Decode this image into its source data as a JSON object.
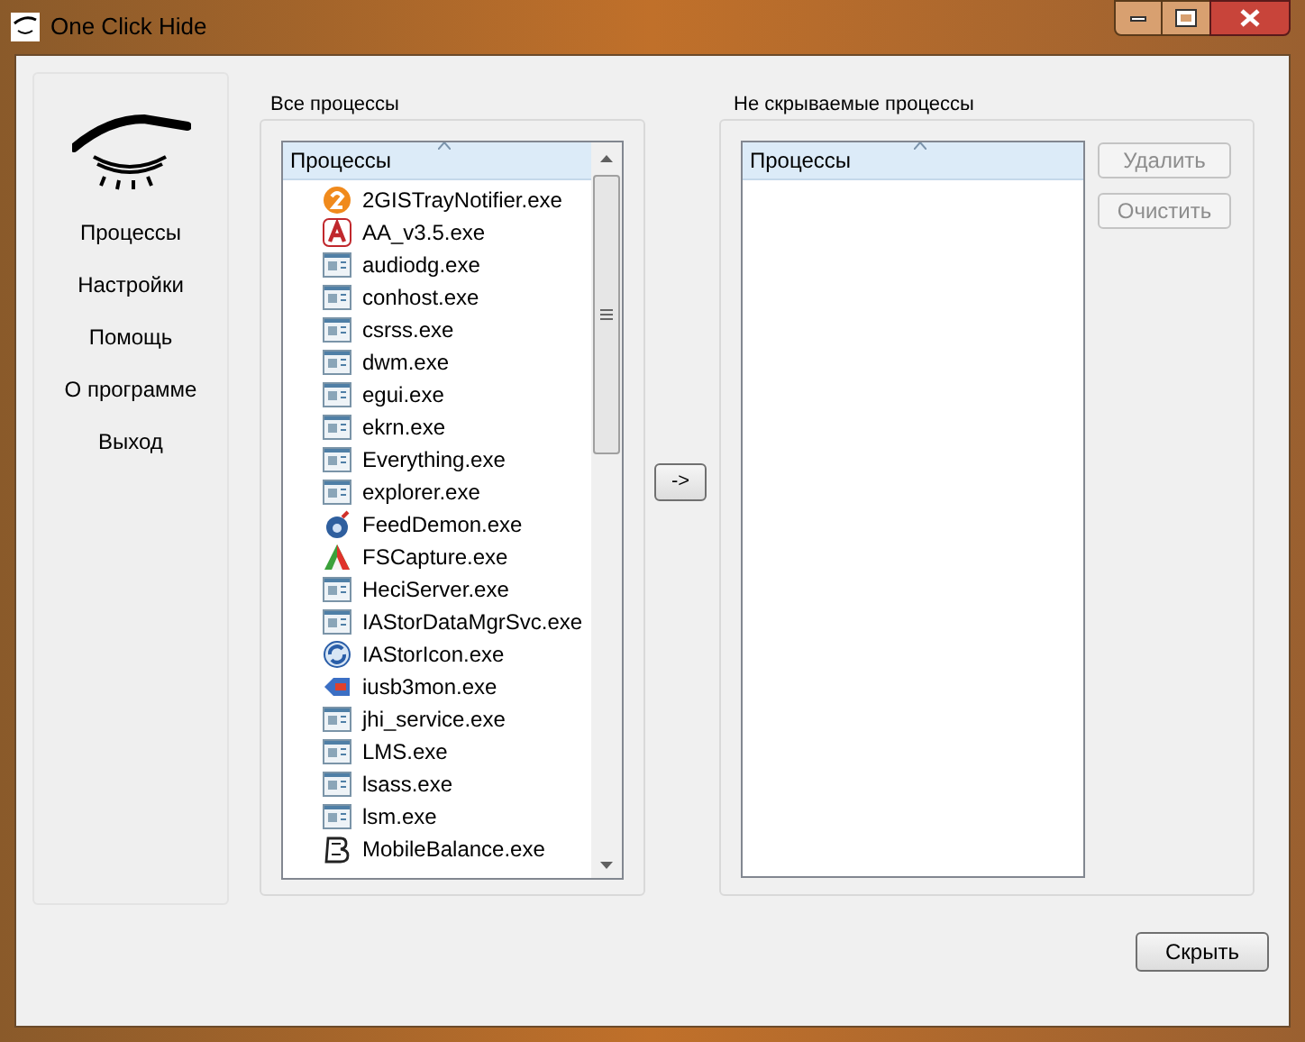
{
  "window": {
    "title": "One Click Hide"
  },
  "sidebar": {
    "items": [
      {
        "label": "Процессы"
      },
      {
        "label": "Настройки"
      },
      {
        "label": "Помощь"
      },
      {
        "label": "О программе"
      },
      {
        "label": "Выход"
      }
    ]
  },
  "all_processes": {
    "title": "Все процессы",
    "column": "Процессы",
    "rows": [
      {
        "name": "2GISTrayNotifier.exe",
        "kind": "orange"
      },
      {
        "name": "AA_v3.5.exe",
        "kind": "red"
      },
      {
        "name": "audiodg.exe",
        "kind": "window"
      },
      {
        "name": "conhost.exe",
        "kind": "window"
      },
      {
        "name": "csrss.exe",
        "kind": "window"
      },
      {
        "name": "dwm.exe",
        "kind": "window"
      },
      {
        "name": "egui.exe",
        "kind": "window"
      },
      {
        "name": "ekrn.exe",
        "kind": "window"
      },
      {
        "name": "Everything.exe",
        "kind": "window"
      },
      {
        "name": "explorer.exe",
        "kind": "window"
      },
      {
        "name": "FeedDemon.exe",
        "kind": "bomb"
      },
      {
        "name": "FSCapture.exe",
        "kind": "capture"
      },
      {
        "name": "HeciServer.exe",
        "kind": "window"
      },
      {
        "name": "IAStorDataMgrSvc.exe",
        "kind": "window"
      },
      {
        "name": "IAStorIcon.exe",
        "kind": "sync"
      },
      {
        "name": "iusb3mon.exe",
        "kind": "usb"
      },
      {
        "name": "jhi_service.exe",
        "kind": "window"
      },
      {
        "name": "LMS.exe",
        "kind": "window"
      },
      {
        "name": "lsass.exe",
        "kind": "window"
      },
      {
        "name": "lsm.exe",
        "kind": "window"
      },
      {
        "name": "MobileBalance.exe",
        "kind": "glyph"
      }
    ]
  },
  "move_button": {
    "label": "->"
  },
  "hidden_processes": {
    "title": "Не скрываемые процессы",
    "column": "Процессы"
  },
  "side_buttons": [
    {
      "label": "Удалить",
      "disabled": true
    },
    {
      "label": "Очистить",
      "disabled": true
    }
  ],
  "hide_button": {
    "label": "Скрыть"
  }
}
